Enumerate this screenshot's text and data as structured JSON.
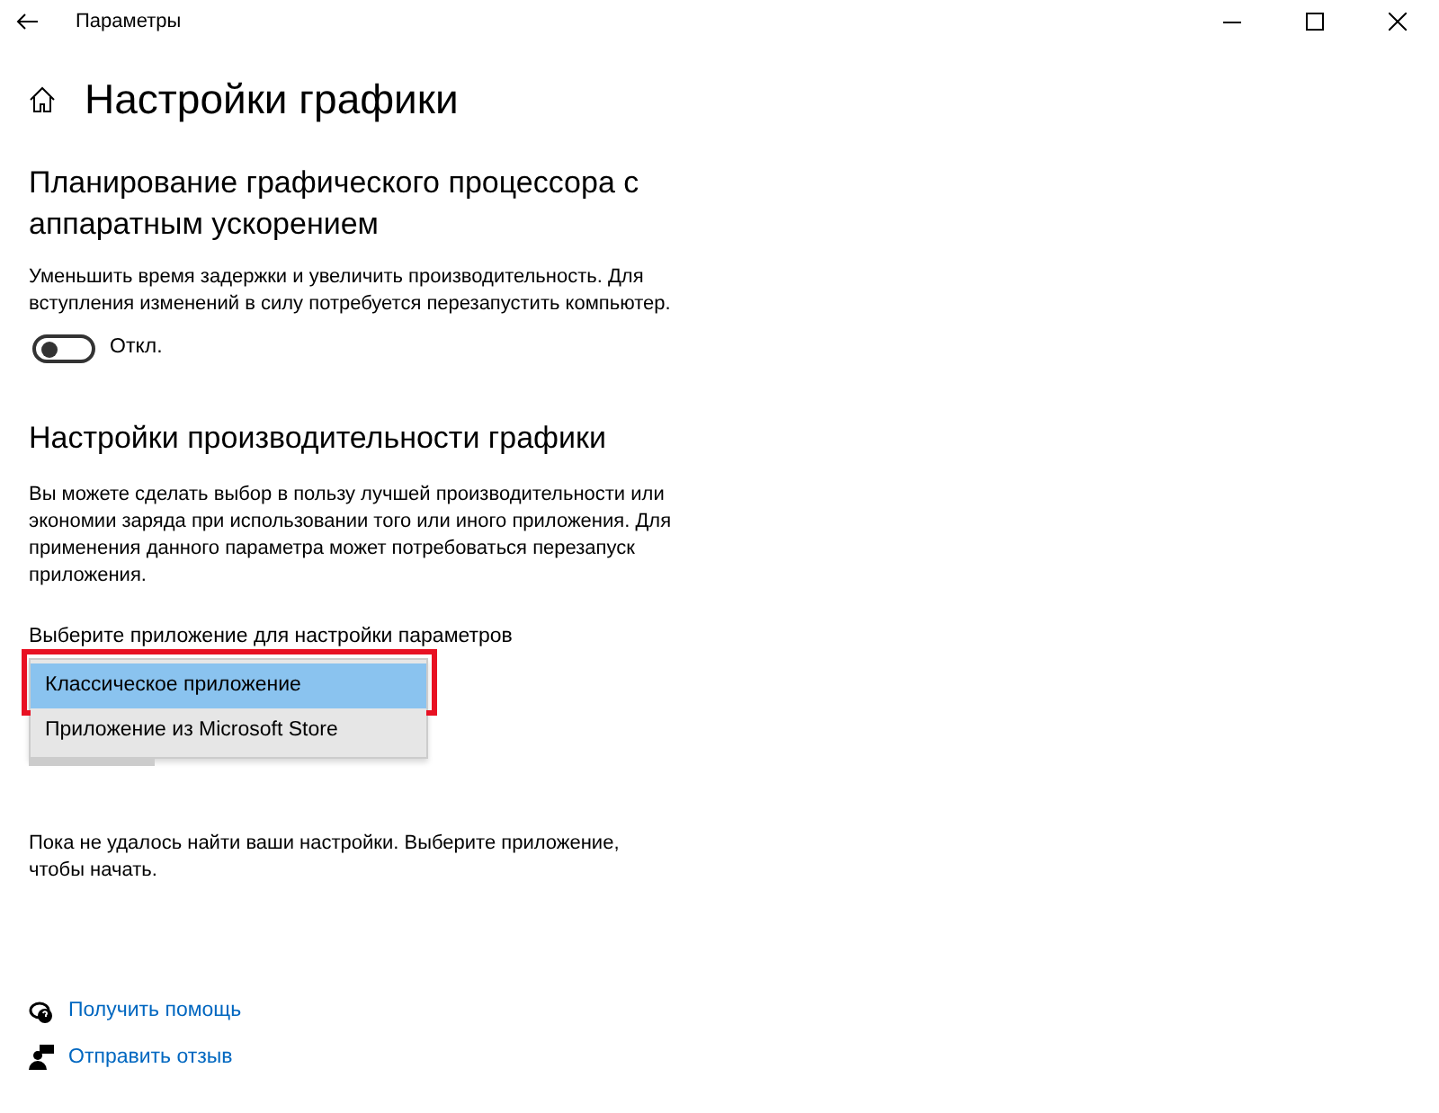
{
  "window": {
    "title": "Параметры"
  },
  "page_title": "Настройки графики",
  "gpu_scheduling": {
    "heading": "Планирование графического процессора с аппаратным ускорением",
    "description": "Уменьшить время задержки и увеличить производительность. Для вступления изменений в силу потребуется перезапустить компьютер.",
    "toggle": {
      "on": false,
      "label": "Откл."
    }
  },
  "performance": {
    "heading": "Настройки производительности графики",
    "description": "Вы можете сделать выбор в пользу лучшей производительности или экономии заряда при использовании того или иного приложения. Для применения данного параметра может потребоваться перезапуск приложения.",
    "dropdown_label": "Выберите приложение для настройки параметров",
    "options": [
      {
        "label": "Классическое приложение",
        "selected": true,
        "outlined": true
      },
      {
        "label": "Приложение из Microsoft Store",
        "selected": false,
        "outlined": false
      }
    ],
    "empty_message": "Пока не удалось найти ваши настройки. Выберите приложение, чтобы начать."
  },
  "links": [
    {
      "kind": "help",
      "label": "Получить помощь"
    },
    {
      "kind": "feedback",
      "label": "Отправить отзыв"
    }
  ]
}
